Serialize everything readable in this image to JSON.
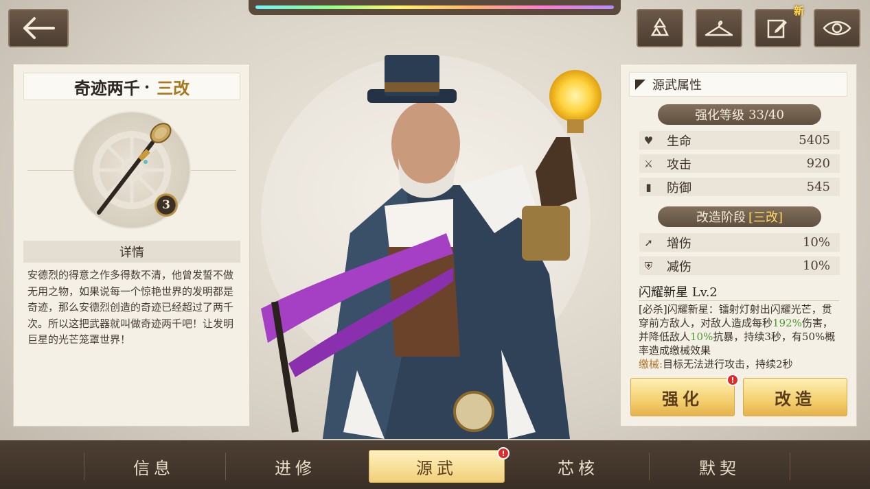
{
  "top_buttons": {
    "back_icon": "arrow-left-icon",
    "recycle_icon": "recycle-icon",
    "outfit_icon": "hanger-icon",
    "edit_icon": "edit-icon",
    "edit_badge": "新",
    "view_icon": "eye-icon"
  },
  "weapon": {
    "name": "奇迹两千",
    "separator": "·",
    "grade": "三改",
    "level_badge": "3",
    "detail_header": "详情",
    "description": "安德烈的得意之作多得数不清，他曾发誓不做无用之物，如果说每一个惊艳世界的发明都是奇迹，那么安德烈创造的奇迹已经超过了两千次。所以这把武器就叫做奇迹两千吧！让发明巨星的光芒笼罩世界！"
  },
  "attributes": {
    "section_title": "源武属性",
    "enhance_label": "强化等级",
    "enhance_value": "33/40",
    "stats": [
      {
        "icon": "heart-icon",
        "name": "生命",
        "value": "5405"
      },
      {
        "icon": "sword-icon",
        "name": "攻击",
        "value": "920"
      },
      {
        "icon": "shield-icon",
        "name": "防御",
        "value": "545"
      }
    ],
    "reform_label": "改造阶段",
    "reform_value": "[三改]",
    "reform_stats": [
      {
        "icon": "damage-up-icon",
        "name": "增伤",
        "value": "10%"
      },
      {
        "icon": "damage-reduce-icon",
        "name": "减伤",
        "value": "10%"
      }
    ]
  },
  "skill": {
    "title": "闪耀新星 Lv.2",
    "desc_part1": "[必杀]闪耀新星：镭射灯射出闪耀光芒，贯穿前方敌人，对敌人造成每秒",
    "desc_highlight1": "192%",
    "desc_part2": "伤害，并降低敌人",
    "desc_highlight2": "10%",
    "desc_part3": "抗暴，持续3秒，有50%概率造成缴械效果",
    "status_name": "缴械:",
    "status_desc": "目标无法进行攻击，持续2秒"
  },
  "actions": {
    "enhance": "强化",
    "enhance_alert": "!",
    "reform": "改造"
  },
  "bottom_nav": {
    "tabs": [
      "信息",
      "进修",
      "源武",
      "芯核",
      "默契"
    ],
    "active_index": 2,
    "alert": "!"
  }
}
